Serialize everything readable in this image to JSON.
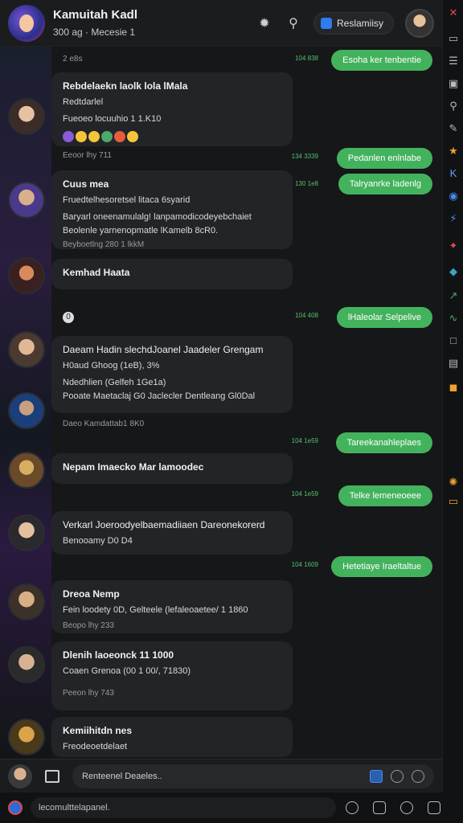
{
  "header": {
    "title": "Kamuitah Kadl",
    "subtitle": "300 ag · Mecesie 1",
    "pill_label": "Reslamiisy",
    "icons": [
      "spider-icon",
      "search-icon",
      "calendar-icon",
      "user-avatar"
    ]
  },
  "messages_left": [
    {
      "title": "Rebdelaekn laolk lola lMala",
      "sub1": "Redtdarlel",
      "sub2": "Fueoeo locuuhio 1 1.K10",
      "meta": "Eeoor lhy 711"
    },
    {
      "title": "Cuus mea",
      "sub1": "Fruedtelhesoretsel litaca 6syarid",
      "sub2": "Baryarl oneenamulalg! lanpamodicodeyebchaiet",
      "sub3": "Beolenle yarnenopmatle lKamelb 8cR0.",
      "meta": "Beyboetlng 280 1 lkkM"
    },
    {
      "title": "Kemhad Haata"
    },
    {
      "title": "Daeam Hadin slechdJoanel Jaadeler Grengam",
      "sub1": "H0aud Ghoog (1eB), 3%",
      "sub2": "Ndedhlien (Gelfeh 1Ge1a)",
      "sub3": "Pooate Maetaclaj G0 Jaclecler Dentleang Gl0Dal",
      "meta": "Daeo Kamdattab1 8K0"
    },
    {
      "title": "Nepam Imaecko Mar lamoodec"
    },
    {
      "title": "Verkarl Joeroodyelbaemadiiaen Dareonekorerd",
      "sub1": "Benooamy D0 D4"
    },
    {
      "title": "Dreoa Nemp",
      "sub1": "Fein loodety 0D, Gelteele (lefaleoaetee/ 1 1860",
      "meta": "Beopo lhy 233"
    },
    {
      "title": "Dlenih laoeonck   11 1000",
      "sub1": "Coaen Grenoa (00 1 00/, 71830)",
      "meta": "Peeon lhy 743"
    },
    {
      "title": "Kemiihitdn nes",
      "sub1": "Freodeoetdelaet"
    }
  ],
  "sys_lines": [
    "2 e8s",
    "0"
  ],
  "bubbles": [
    {
      "text": "Esoha ker tenbentie",
      "stamp": "104 838"
    },
    {
      "text": "Pedanlen enlnlabe",
      "stamp": "134 3339"
    },
    {
      "text": "Talryanrke ladenlg",
      "stamp": "130 1e8"
    },
    {
      "text": "lHaleolar Selpelive",
      "stamp": "104 408"
    },
    {
      "text": "Tareekanahleplaes",
      "stamp": "104 1e59"
    },
    {
      "text": "Telke lemeneoeee",
      "stamp": "104 1e59"
    },
    {
      "text": "Hetetiaye Iraeltaltue",
      "stamp": "104 1609"
    }
  ],
  "composer": {
    "placeholder": "Renteenel Deaeles.."
  },
  "bottom_bar": {
    "placeholder": "lecomulttelapanel."
  }
}
